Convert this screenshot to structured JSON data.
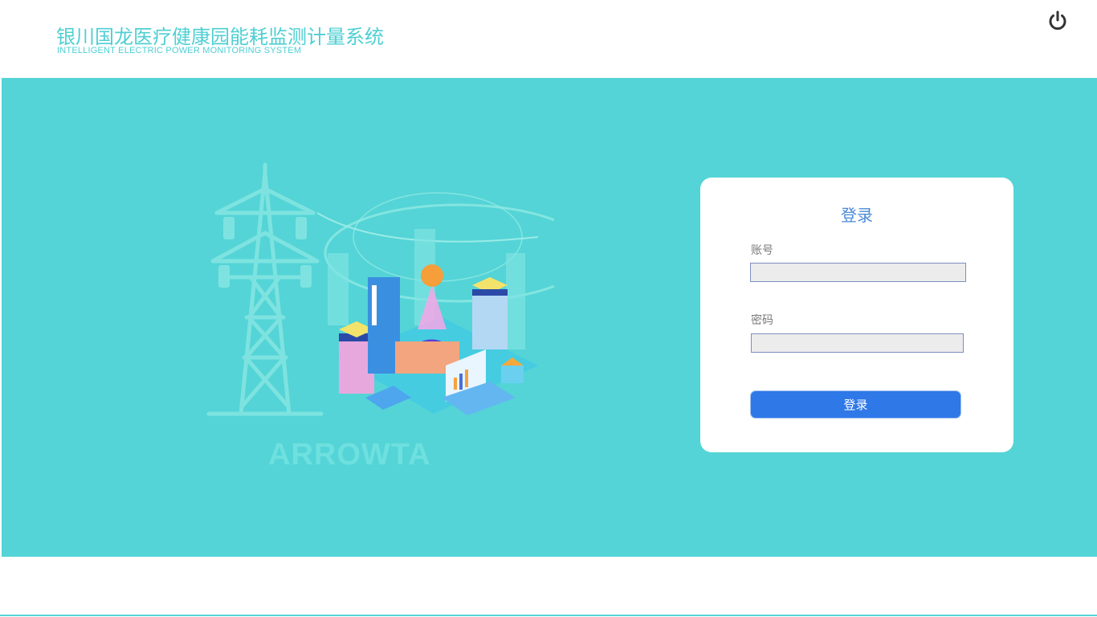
{
  "header": {
    "title_zh": "银川国龙医疗健康园能耗监测计量系统",
    "title_en": "INTELLIGENT ELECTRIC POWER MONITORING SYSTEM",
    "power_icon": "power-icon"
  },
  "banner": {
    "watermark": "ARROWTA",
    "illustration": "power-tower-smart-city-illustration"
  },
  "login": {
    "title": "登录",
    "account_label": "账号",
    "account_value": "",
    "password_label": "密码",
    "password_value": "",
    "submit_label": "登录"
  },
  "colors": {
    "brand_teal": "#54d4d6",
    "title_teal": "#4ecfd3",
    "login_blue": "#2f78e7",
    "login_title_blue": "#4a8ad8"
  }
}
